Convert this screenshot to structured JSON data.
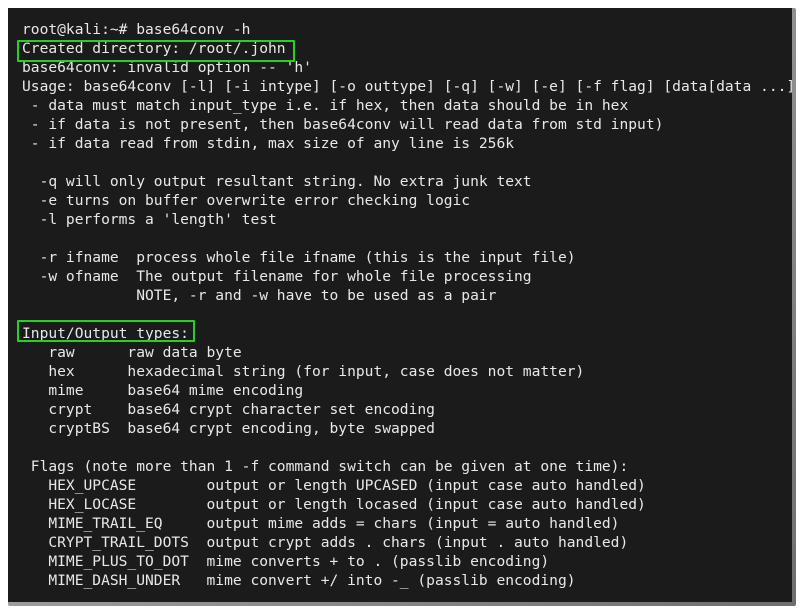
{
  "window": {
    "type": "terminal",
    "background_color": "#1b1b1b",
    "text_color": "#e8e8e8",
    "frame_color": "#ffffff",
    "highlight_color": "#27d027"
  },
  "terminal": {
    "prompt": "root@kali:~# ",
    "command": "base64conv -h",
    "lines": [
      "root@kali:~# base64conv -h",
      "Created directory: /root/.john",
      "base64conv: invalid option -- 'h'",
      "Usage: base64conv [-l] [-i intype] [-o outtype] [-q] [-w] [-e] [-f flag] [data[data ...]",
      " - data must match input_type i.e. if hex, then data should be in hex",
      " - if data is not present, then base64conv will read data from std input)",
      " - if data read from stdin, max size of any line is 256k",
      "",
      "  -q will only output resultant string. No extra junk text",
      "  -e turns on buffer overwrite error checking logic",
      "  -l performs a 'length' test",
      "",
      "  -r ifname  process whole file ifname (this is the input file)",
      "  -w ofname  The output filename for whole file processing",
      "             NOTE, -r and -w have to be used as a pair",
      "",
      "Input/Output types:",
      "   raw      raw data byte",
      "   hex      hexadecimal string (for input, case does not matter)",
      "   mime     base64 mime encoding",
      "   crypt    base64 crypt character set encoding",
      "   cryptBS  base64 crypt encoding, byte swapped",
      "",
      " Flags (note more than 1 -f command switch can be given at one time):",
      "   HEX_UPCASE        output or length UPCASED (input case auto handled)",
      "   HEX_LOCASE        output or length locased (input case auto handled)",
      "   MIME_TRAIL_EQ     output mime adds = chars (input = auto handled)",
      "   CRYPT_TRAIL_DOTS  output crypt adds . chars (input . auto handled)",
      "   MIME_PLUS_TO_DOT  mime converts + to . (passlib encoding)",
      "   MIME_DASH_UNDER   mime convert +/ into -_ (passlib encoding)"
    ]
  },
  "annotations": {
    "created_directory_box": {
      "label": "Created directory: /root/.john",
      "color": "#27d027"
    },
    "io_types_box": {
      "label": "Input/Output types:",
      "color": "#27d027"
    }
  }
}
